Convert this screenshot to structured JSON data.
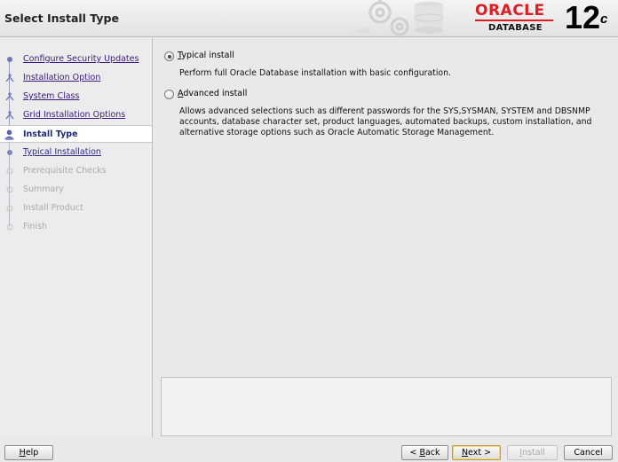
{
  "header": {
    "title": "Select Install Type",
    "logo_word": "ORACLE",
    "logo_sub": "DATABASE",
    "version": "12",
    "version_suffix": "c"
  },
  "nav": {
    "steps": [
      {
        "label": "Configure Security Updates",
        "state": "done"
      },
      {
        "label": "Installation Option",
        "state": "done"
      },
      {
        "label": "System Class",
        "state": "done"
      },
      {
        "label": "Grid Installation Options",
        "state": "done"
      },
      {
        "label": "Install Type",
        "state": "current"
      },
      {
        "label": "Typical Installation",
        "state": "next"
      },
      {
        "label": "Prerequisite Checks",
        "state": "disabled"
      },
      {
        "label": "Summary",
        "state": "disabled"
      },
      {
        "label": "Install Product",
        "state": "disabled"
      },
      {
        "label": "Finish",
        "state": "disabled"
      }
    ]
  },
  "options": {
    "typical": {
      "mnemonic": "T",
      "label_rest": "ypical install",
      "selected": true,
      "description": "Perform full Oracle Database installation with basic configuration."
    },
    "advanced": {
      "mnemonic": "A",
      "label_rest": "dvanced install",
      "selected": false,
      "description_lines": [
        "Allows advanced selections such as different passwords for the SYS,SYSMAN, SYSTEM and DBSNMP",
        "accounts, database character set, product languages, automated backups, custom installation, and",
        "alternative storage options such as Oracle Automatic Storage Management."
      ]
    }
  },
  "buttons": {
    "help": {
      "mnemonic": "H",
      "rest": "elp"
    },
    "back": {
      "pre": "< ",
      "mnemonic": "B",
      "rest": "ack"
    },
    "next": {
      "mnemonic": "N",
      "rest": "ext >"
    },
    "install": {
      "mnemonic": "I",
      "rest": "nstall"
    },
    "cancel": {
      "label": "Cancel"
    }
  },
  "colors": {
    "oracle_red": "#e01b22",
    "current_step": "#1b2c7a",
    "visited_link": "#3a1a80",
    "disabled_text": "#aaaaaa"
  }
}
